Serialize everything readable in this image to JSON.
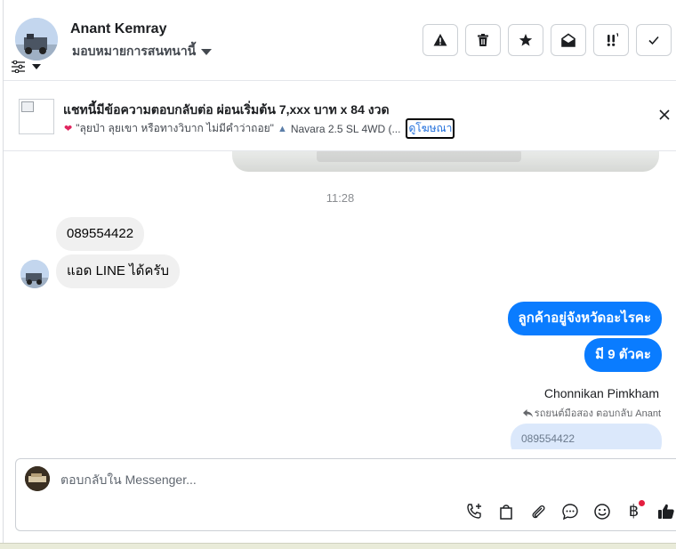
{
  "header": {
    "contact_name": "Anant Kemray",
    "assign_label": "มอบหมายการสนทนานี้",
    "actions": [
      {
        "icon": "warning-icon",
        "label": "Mark as spam"
      },
      {
        "icon": "trash-icon",
        "label": "Delete"
      },
      {
        "icon": "star-icon",
        "label": "Star"
      },
      {
        "icon": "envelope-open-icon",
        "label": "Mark as unread"
      },
      {
        "icon": "follow-up-icon",
        "label": "Follow up"
      },
      {
        "icon": "check-icon",
        "label": "Mark as done"
      }
    ]
  },
  "banner": {
    "title": "แชทนี้มีข้อความตอบกลับต่อ ผ่อนเริ่มต้น 7,xxx บาท x 84 งวด",
    "subtitle": "\"ลุยป่า ลุยเขา หรือทางวิบาก ไม่มีคำว่าถอย\"",
    "subtitle_2": "Navara 2.5 SL 4WD (...",
    "ad_link": "ดูโฆษณา"
  },
  "chat": {
    "time": "11:28",
    "incoming": [
      "089554422",
      "แอด LINE ได้ครับ"
    ],
    "outgoing": [
      "ลูกค้าอยู่จังหวัดอะไรคะ",
      "มี 9 ตัวคะ"
    ],
    "sender_name": "Chonnikan Pimkham",
    "reply_note": "รถยนต์มือสอง ตอบกลับ Anant",
    "reply_preview": "089554422"
  },
  "composer": {
    "placeholder": "ตอบกลับใน Messenger...",
    "baht_symbol": "฿"
  },
  "colors": {
    "accent": "#0a7cff",
    "incoming_bubble": "#f0f0f0",
    "reply_bubble": "#dbe8fb",
    "notification_dot": "#e41e3f"
  }
}
